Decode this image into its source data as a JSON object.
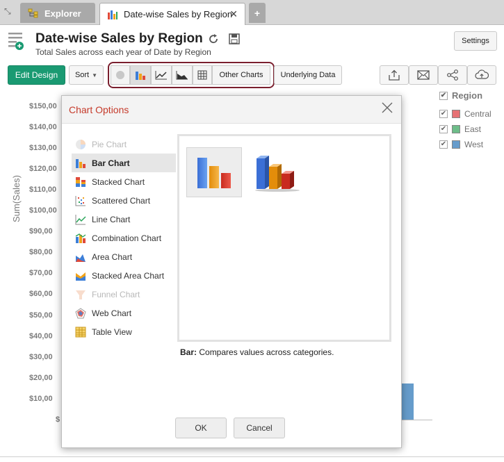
{
  "tabs": [
    {
      "label": "Explorer",
      "icon": "tree-icon"
    },
    {
      "label": "Date-wise Sales by Region",
      "icon": "bar-chart-icon"
    }
  ],
  "header": {
    "title": "Date-wise Sales by Region",
    "subtitle": "Total Sales across each year of Date by Region",
    "settings_label": "Settings"
  },
  "toolbar": {
    "edit_label": "Edit Design",
    "sort_label": "Sort",
    "other_charts_label": "Other Charts",
    "underlying_label": "Underlying Data"
  },
  "chart": {
    "ylabel": "Sum(Sales)",
    "ticks": [
      "$150,00",
      "$140,00",
      "$130,00",
      "$120,00",
      "$110,00",
      "$100,00",
      "$90,00",
      "$80,00",
      "$70,00",
      "$60,00",
      "$50,00",
      "$40,00",
      "$30,00",
      "$20,00",
      "$10,00",
      "$"
    ]
  },
  "legend": {
    "title": "Region",
    "items": [
      {
        "label": "Central",
        "color": "#d9262a"
      },
      {
        "label": "East",
        "color": "#1f9a4a"
      },
      {
        "label": "West",
        "color": "#1467b0"
      }
    ]
  },
  "modal": {
    "title": "Chart Options",
    "types": [
      {
        "label": "Pie Chart",
        "disabled": true,
        "selected": false,
        "icon": "pie-chart-icon"
      },
      {
        "label": "Bar Chart",
        "disabled": false,
        "selected": true,
        "icon": "bar-chart-icon"
      },
      {
        "label": "Stacked Chart",
        "disabled": false,
        "selected": false,
        "icon": "stacked-chart-icon"
      },
      {
        "label": "Scattered Chart",
        "disabled": false,
        "selected": false,
        "icon": "scatter-chart-icon"
      },
      {
        "label": "Line Chart",
        "disabled": false,
        "selected": false,
        "icon": "line-chart-icon"
      },
      {
        "label": "Combination Chart",
        "disabled": false,
        "selected": false,
        "icon": "combination-chart-icon"
      },
      {
        "label": "Area Chart",
        "disabled": false,
        "selected": false,
        "icon": "area-chart-icon"
      },
      {
        "label": "Stacked Area Chart",
        "disabled": false,
        "selected": false,
        "icon": "stacked-area-chart-icon"
      },
      {
        "label": "Funnel Chart",
        "disabled": true,
        "selected": false,
        "icon": "funnel-chart-icon"
      },
      {
        "label": "Web Chart",
        "disabled": false,
        "selected": false,
        "icon": "web-chart-icon"
      },
      {
        "label": "Table View",
        "disabled": false,
        "selected": false,
        "icon": "table-view-icon"
      }
    ],
    "desc_label": "Bar:",
    "desc_text": " Compares values across categories.",
    "ok_label": "OK",
    "cancel_label": "Cancel"
  }
}
